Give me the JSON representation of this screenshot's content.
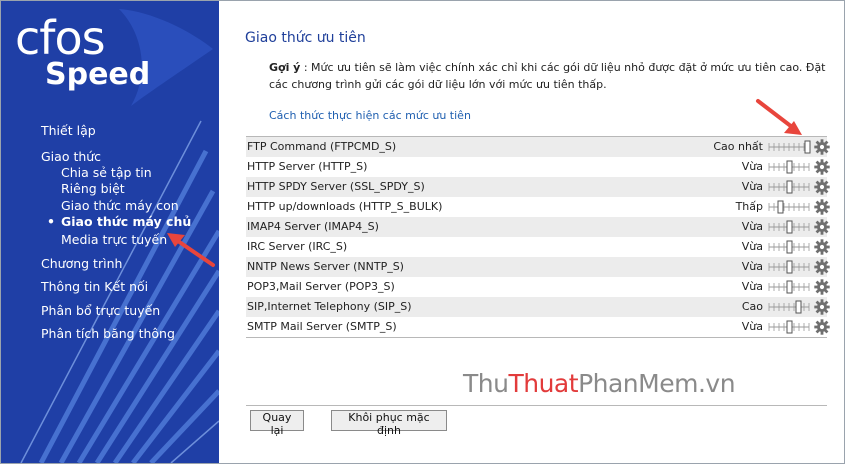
{
  "logo": {
    "line1": "cfos",
    "line2": "Speed"
  },
  "sidebar": {
    "items": [
      {
        "label": "Thiết lập"
      },
      {
        "label": "Giao thức"
      },
      {
        "label": "Chia sẻ tập tin"
      },
      {
        "label": "Riêng biệt"
      },
      {
        "label": "Giao thức máy con"
      },
      {
        "label": "Giao thức máy chủ"
      },
      {
        "label": "Media trực tuyến"
      },
      {
        "label": "Chương trình"
      },
      {
        "label": "Thông tin Kết nối"
      },
      {
        "label": "Phân bổ trực tuyến"
      },
      {
        "label": "Phân tích băng thông"
      }
    ],
    "bullet": "•"
  },
  "main": {
    "title": "Giao thức ưu tiên",
    "hint_label": "Gợi ý",
    "hint_text": " : Mức ưu tiên sẽ làm việc chính xác chỉ khi các gói dữ liệu nhỏ được đặt ở mức ưu tiên cao. Đặt các chương trình gửi các gói dữ liệu lớn với mức ưu tiên thấp.",
    "link": "Cách thức thực hiện các mức ưu tiên"
  },
  "protocols": [
    {
      "name": "FTP Command (FTPCMD_S)",
      "priority": "Cao nhất",
      "level": 1.0
    },
    {
      "name": "HTTP Server (HTTP_S)",
      "priority": "Vừa",
      "level": 0.5
    },
    {
      "name": "HTTP SPDY Server (SSL_SPDY_S)",
      "priority": "Vừa",
      "level": 0.5
    },
    {
      "name": "HTTP up/downloads (HTTP_S_BULK)",
      "priority": "Thấp",
      "level": 0.25
    },
    {
      "name": "IMAP4 Server (IMAP4_S)",
      "priority": "Vừa",
      "level": 0.5
    },
    {
      "name": "IRC Server (IRC_S)",
      "priority": "Vừa",
      "level": 0.5
    },
    {
      "name": "NNTP News Server (NNTP_S)",
      "priority": "Vừa",
      "level": 0.5
    },
    {
      "name": "POP3,Mail Server (POP3_S)",
      "priority": "Vừa",
      "level": 0.5
    },
    {
      "name": "SIP,Internet Telephony (SIP_S)",
      "priority": "Cao",
      "level": 0.75
    },
    {
      "name": "SMTP Mail Server (SMTP_S)",
      "priority": "Vừa",
      "level": 0.5
    }
  ],
  "buttons": {
    "back": "Quay lại",
    "reset": "Khôi phục mặc định"
  },
  "watermark": {
    "part1": "Thu",
    "part2": "Thuat",
    "part3": "PhanMem",
    "part4": ".vn"
  },
  "colors": {
    "sidebar": "#1f3fa6",
    "title": "#1f3f9a",
    "link": "#1f5fb0",
    "arrow": "#e8453c"
  }
}
